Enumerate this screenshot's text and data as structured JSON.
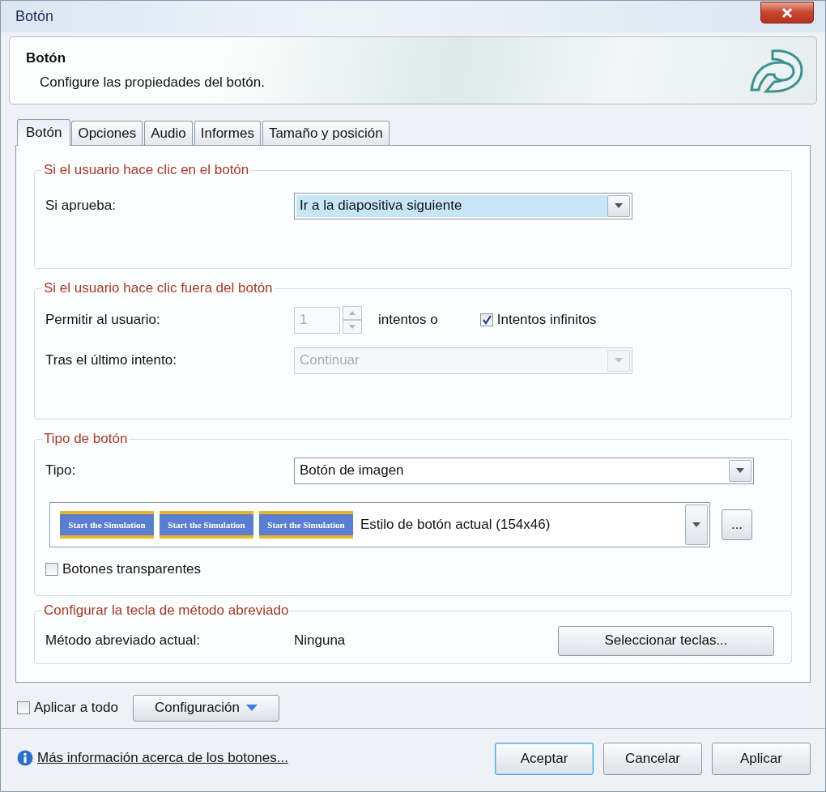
{
  "window": {
    "title": "Botón"
  },
  "header": {
    "title": "Botón",
    "description": "Configure las propiedades del botón."
  },
  "tabs": [
    {
      "label": "Botón",
      "selected": true
    },
    {
      "label": "Opciones",
      "selected": false
    },
    {
      "label": "Audio",
      "selected": false
    },
    {
      "label": "Informes",
      "selected": false
    },
    {
      "label": "Tamaño y posición",
      "selected": false
    }
  ],
  "on_click": {
    "legend": "Si el usuario hace clic en el botón",
    "if_passed": {
      "label": "Si aprueba:",
      "value": "Ir a la diapositiva siguiente",
      "highlighted": true
    }
  },
  "click_outside": {
    "legend": "Si el usuario hace clic fuera del botón",
    "attempts": {
      "label": "Permitir al usuario:",
      "value": "1",
      "disabled": true,
      "suffix": "intentos o"
    },
    "infinite": {
      "label": "Intentos infinitos",
      "checked": true
    },
    "after_last": {
      "label": "Tras el último intento:",
      "value": "Continuar",
      "disabled": true
    }
  },
  "button_type": {
    "legend": "Tipo de botón",
    "type": {
      "label": "Tipo:",
      "value": "Botón de imagen"
    },
    "style": {
      "previews": [
        "Start the Simulation",
        "Start the Simulation",
        "Start the Simulation"
      ],
      "value": "Estilo de botón actual (154x46)",
      "more": "..."
    },
    "transparent": {
      "label": "Botones transparentes",
      "checked": false
    }
  },
  "shortcut": {
    "legend": "Configurar la tecla de método abreviado",
    "label": "Método abreviado actual:",
    "value": "Ninguna",
    "button": "Seleccionar teclas..."
  },
  "apply_all": {
    "label": "Aplicar a todo",
    "checked": false
  },
  "config_button": "Configuración",
  "footer": {
    "link": "Más información acerca de los botones...",
    "buttons": [
      {
        "label": "Aceptar",
        "default": true
      },
      {
        "label": "Cancelar",
        "default": false
      },
      {
        "label": "Aplicar",
        "default": false
      }
    ]
  }
}
